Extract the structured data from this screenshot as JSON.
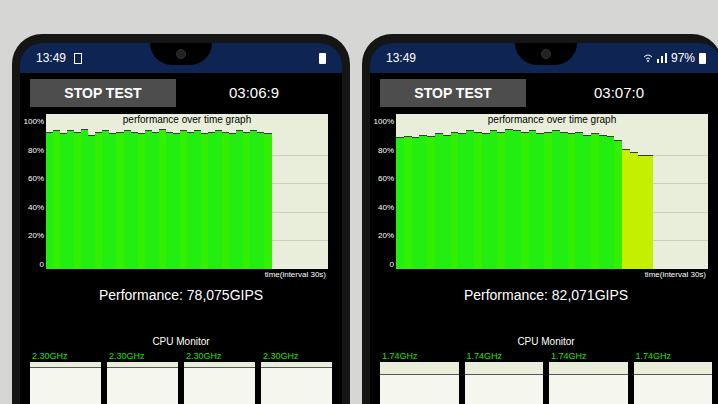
{
  "phones": [
    {
      "status": {
        "time": "13:49",
        "battery": ""
      },
      "button": "STOP TEST",
      "timer": "03:06:9",
      "graph": {
        "title": "performance over time graph",
        "y_ticks": [
          "100%",
          "80%",
          "60%",
          "40%",
          "20%",
          "0"
        ],
        "x_label": "time(interval 30s)",
        "values": [
          96,
          97,
          95,
          97,
          96,
          98,
          94,
          96,
          97,
          95,
          96,
          97,
          96,
          95,
          97,
          96,
          98,
          96,
          95,
          97,
          96,
          97,
          95,
          96,
          97,
          96,
          95,
          97,
          96,
          97,
          96,
          95
        ]
      },
      "performance": "Performance: 78,075GIPS",
      "cpu_monitor": {
        "title": "CPU Monitor",
        "cores": [
          {
            "label": "2.30GHz",
            "level": 0.92
          },
          {
            "label": "2.30GHz",
            "level": 0.92
          },
          {
            "label": "2.30GHz",
            "level": 0.92
          },
          {
            "label": "2.30GHz",
            "level": 0.92
          }
        ]
      }
    },
    {
      "status": {
        "time": "13:49",
        "battery": "97%"
      },
      "button": "STOP TEST",
      "timer": "03:07:0",
      "graph": {
        "title": "performance over time graph",
        "y_ticks": [
          "100%",
          "80%",
          "60%",
          "40%",
          "20%",
          "0"
        ],
        "x_label": "time(interval 30s)",
        "values": [
          92,
          93,
          92,
          94,
          93,
          95,
          94,
          96,
          95,
          97,
          96,
          95,
          97,
          96,
          98,
          97,
          96,
          97,
          95,
          96,
          97,
          96,
          95,
          96,
          94,
          95,
          94,
          93,
          90,
          84,
          82,
          80,
          80
        ]
      },
      "performance": "Performance: 82,071GIPS",
      "cpu_monitor": {
        "title": "CPU Monitor",
        "cores": [
          {
            "label": "1.74GHz",
            "level": 0.8
          },
          {
            "label": "1.74GHz",
            "level": 0.8
          },
          {
            "label": "1.74GHz",
            "level": 0.8
          },
          {
            "label": "1.74GHz",
            "level": 0.8
          }
        ]
      }
    }
  ]
}
